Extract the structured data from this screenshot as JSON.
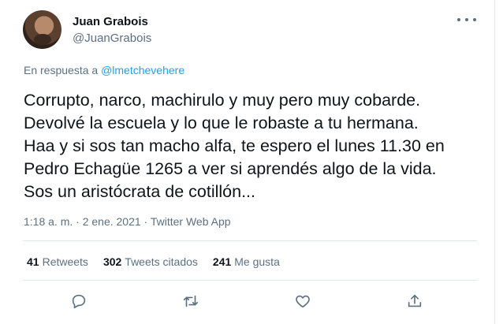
{
  "author": {
    "name": "Juan Grabois",
    "handle": "@JuanGrabois"
  },
  "reply_context": {
    "prefix": "En respuesta a",
    "mention": "@lmetchevehere"
  },
  "tweet_text": "Corrupto, narco, machirulo y muy pero muy cobarde.\nDevolvé la escuela y lo que le robaste a tu hermana.\nHaa y si sos tan macho alfa, te espero el lunes 11.30 en\nPedro Echagüe 1265 a ver si aprendés algo de la vida.\nSos un aristócrata de cotillón...",
  "meta": "1:18 a. m. · 2 ene. 2021 · Twitter Web App",
  "stats": {
    "retweets": {
      "count": "41",
      "label": "Retweets"
    },
    "quotes": {
      "count": "302",
      "label": "Tweets citados"
    },
    "likes": {
      "count": "241",
      "label": "Me gusta"
    }
  },
  "icons": {
    "more": "more-icon",
    "reply": "reply-icon",
    "retweet": "retweet-icon",
    "like": "like-icon",
    "share": "share-icon"
  },
  "colors": {
    "link": "#1da1f2",
    "secondary": "#5b7083",
    "text": "#0f1419",
    "divider": "#e1e8ed"
  }
}
